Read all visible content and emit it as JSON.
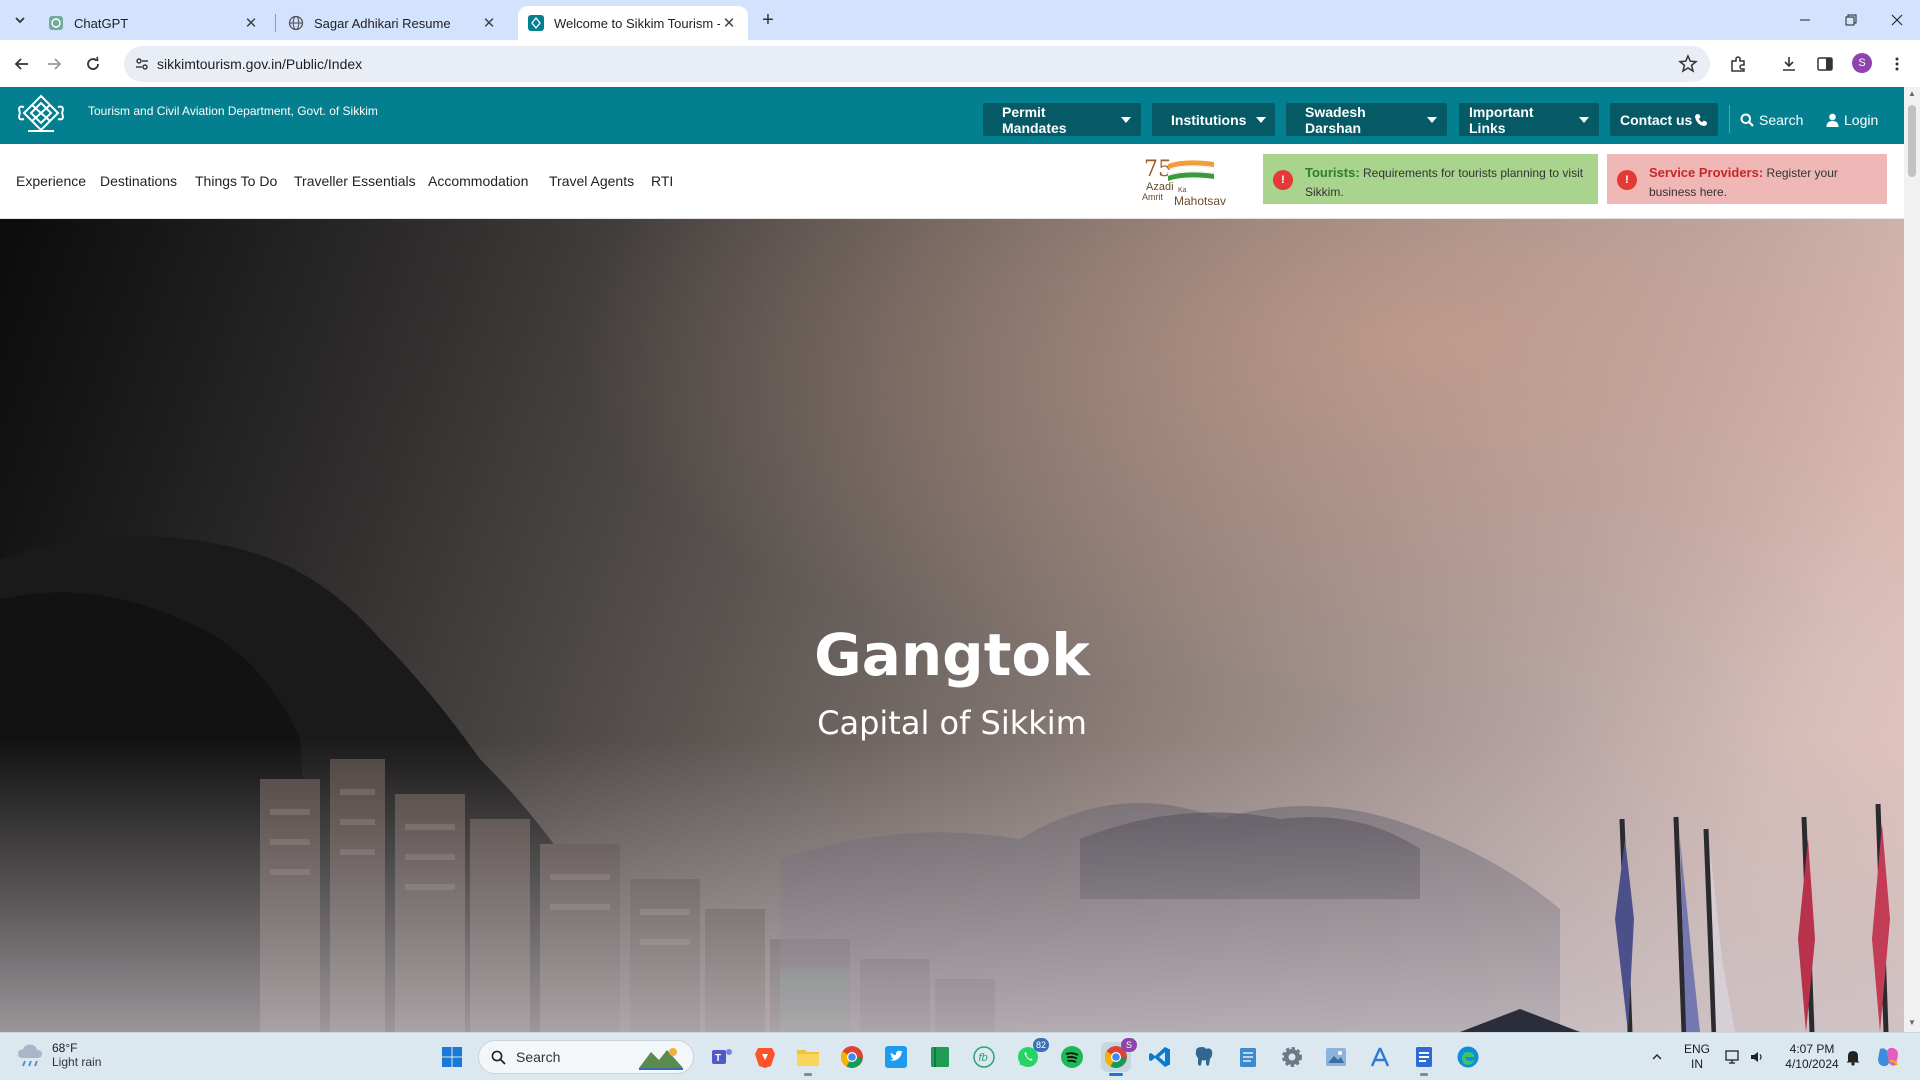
{
  "browser": {
    "tabs": [
      {
        "title": "ChatGPT",
        "active": false
      },
      {
        "title": "Sagar Adhikari Resume",
        "active": false
      },
      {
        "title": "Welcome to Sikkim Tourism - C",
        "active": true
      }
    ],
    "url": "sikkimtourism.gov.in/Public/Index",
    "profile_initial": "S"
  },
  "site": {
    "department": "Tourism and Civil Aviation Department, Govt. of Sikkim",
    "top_nav": {
      "permit": "Permit Mandates",
      "institutions": "Institutions",
      "swadesh": "Swadesh Darshan",
      "important_links": "Important Links",
      "contact": "Contact us",
      "search": "Search",
      "login": "Login"
    },
    "main_nav": [
      "Experience",
      "Destinations",
      "Things To Do",
      "Traveller Essentials",
      "Accommodation",
      "Travel Agents",
      "RTI"
    ],
    "azadi_logo": {
      "line1": "Azadi",
      "ka": "Ka",
      "line2": "Amrit",
      "line3": "Mahotsav",
      "number": "75"
    },
    "alerts": {
      "tourists": {
        "title": "Tourists:",
        "text": "Requirements for tourists planning to visit Sikkim."
      },
      "providers": {
        "title": "Service Providers:",
        "text": "Register your business here."
      }
    },
    "hero": {
      "title": "Gangtok",
      "subtitle": "Capital of Sikkim"
    }
  },
  "taskbar": {
    "weather": {
      "temp": "68°F",
      "condition": "Light rain"
    },
    "search_label": "Search",
    "badges": {
      "whatsapp": "82",
      "chrome": "S"
    },
    "lang": {
      "line1": "ENG",
      "line2": "IN"
    },
    "clock": {
      "time": "4:07 PM",
      "date": "4/10/2024"
    }
  },
  "colors": {
    "brand_teal": "#037f8f",
    "nav_button": "#055a66",
    "tourists_bg": "#a9d48d",
    "providers_bg": "#f0b7b7"
  }
}
